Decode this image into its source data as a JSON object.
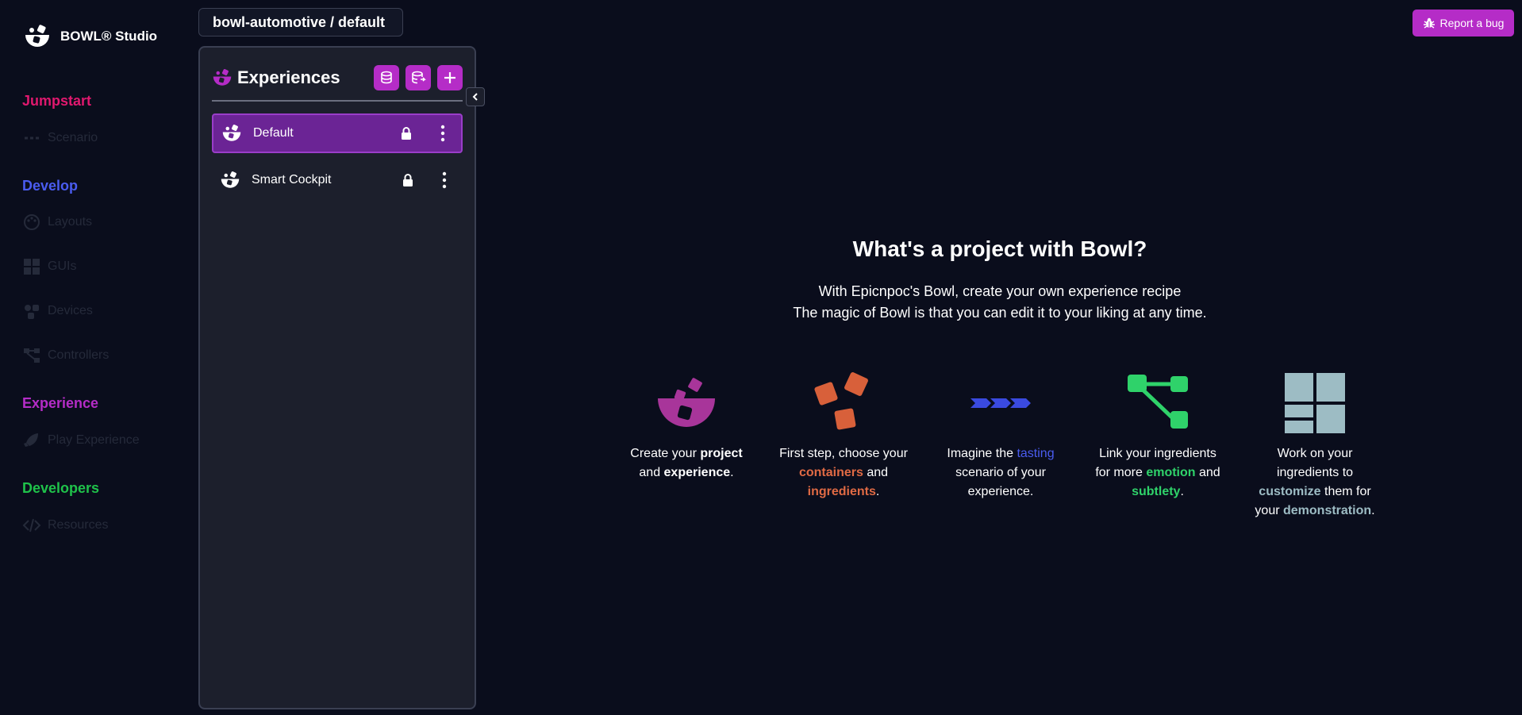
{
  "brand": {
    "name": "BOWL® Studio"
  },
  "nav": {
    "sections": [
      {
        "label": "Jumpstart",
        "color": "#e0186e",
        "items": [
          {
            "label": "Scenario",
            "icon": "scenario-icon"
          }
        ]
      },
      {
        "label": "Develop",
        "color": "#4a5cf0",
        "items": [
          {
            "label": "Layouts",
            "icon": "palette-icon"
          },
          {
            "label": "GUIs",
            "icon": "grid-icon"
          },
          {
            "label": "Devices",
            "icon": "devices-icon"
          },
          {
            "label": "Controllers",
            "icon": "controllers-icon"
          }
        ]
      },
      {
        "label": "Experience",
        "color": "#b52cc7",
        "items": [
          {
            "label": "Play Experience",
            "icon": "rocket-icon"
          }
        ]
      },
      {
        "label": "Developers",
        "color": "#1fc24a",
        "items": [
          {
            "label": "Resources",
            "icon": "code-icon"
          }
        ]
      }
    ]
  },
  "project": {
    "path": "bowl-automotive / default"
  },
  "panel": {
    "title": "Experiences",
    "items": [
      {
        "label": "Default",
        "active": true
      },
      {
        "label": "Smart Cockpit",
        "active": false
      }
    ]
  },
  "report": {
    "label": "Report a bug"
  },
  "main": {
    "title": "What's a project with Bowl?",
    "line1": "With Epicnpoc's Bowl, create your own experience recipe",
    "line2": "The magic of Bowl is that you can edit it to your liking at any time.",
    "features": [
      {
        "parts": [
          "Create your ",
          "project",
          " and ",
          "experience",
          "."
        ],
        "color": "#ffffff"
      },
      {
        "parts": [
          "First step, choose your ",
          "containers",
          " and ",
          "ingredients",
          "."
        ],
        "color": "#e06a44"
      },
      {
        "parts": [
          "Imagine the ",
          "tasting",
          " scenario of your experience."
        ],
        "color": "#4a5cf0"
      },
      {
        "parts": [
          "Link your ingredients for more ",
          "emotion",
          " and ",
          "subtlety",
          "."
        ],
        "color": "#2fd26a"
      },
      {
        "parts": [
          "Work on your ingredients to ",
          "customize",
          " them for your ",
          "demonstration",
          "."
        ],
        "color": "#9dbcc4"
      }
    ]
  },
  "colors": {
    "accent": "#b52cc7",
    "activeItem": "#6b2495",
    "orange": "#e06a44",
    "blue": "#4a5cf0",
    "green": "#2fd26a",
    "slate": "#9dbcc4"
  }
}
